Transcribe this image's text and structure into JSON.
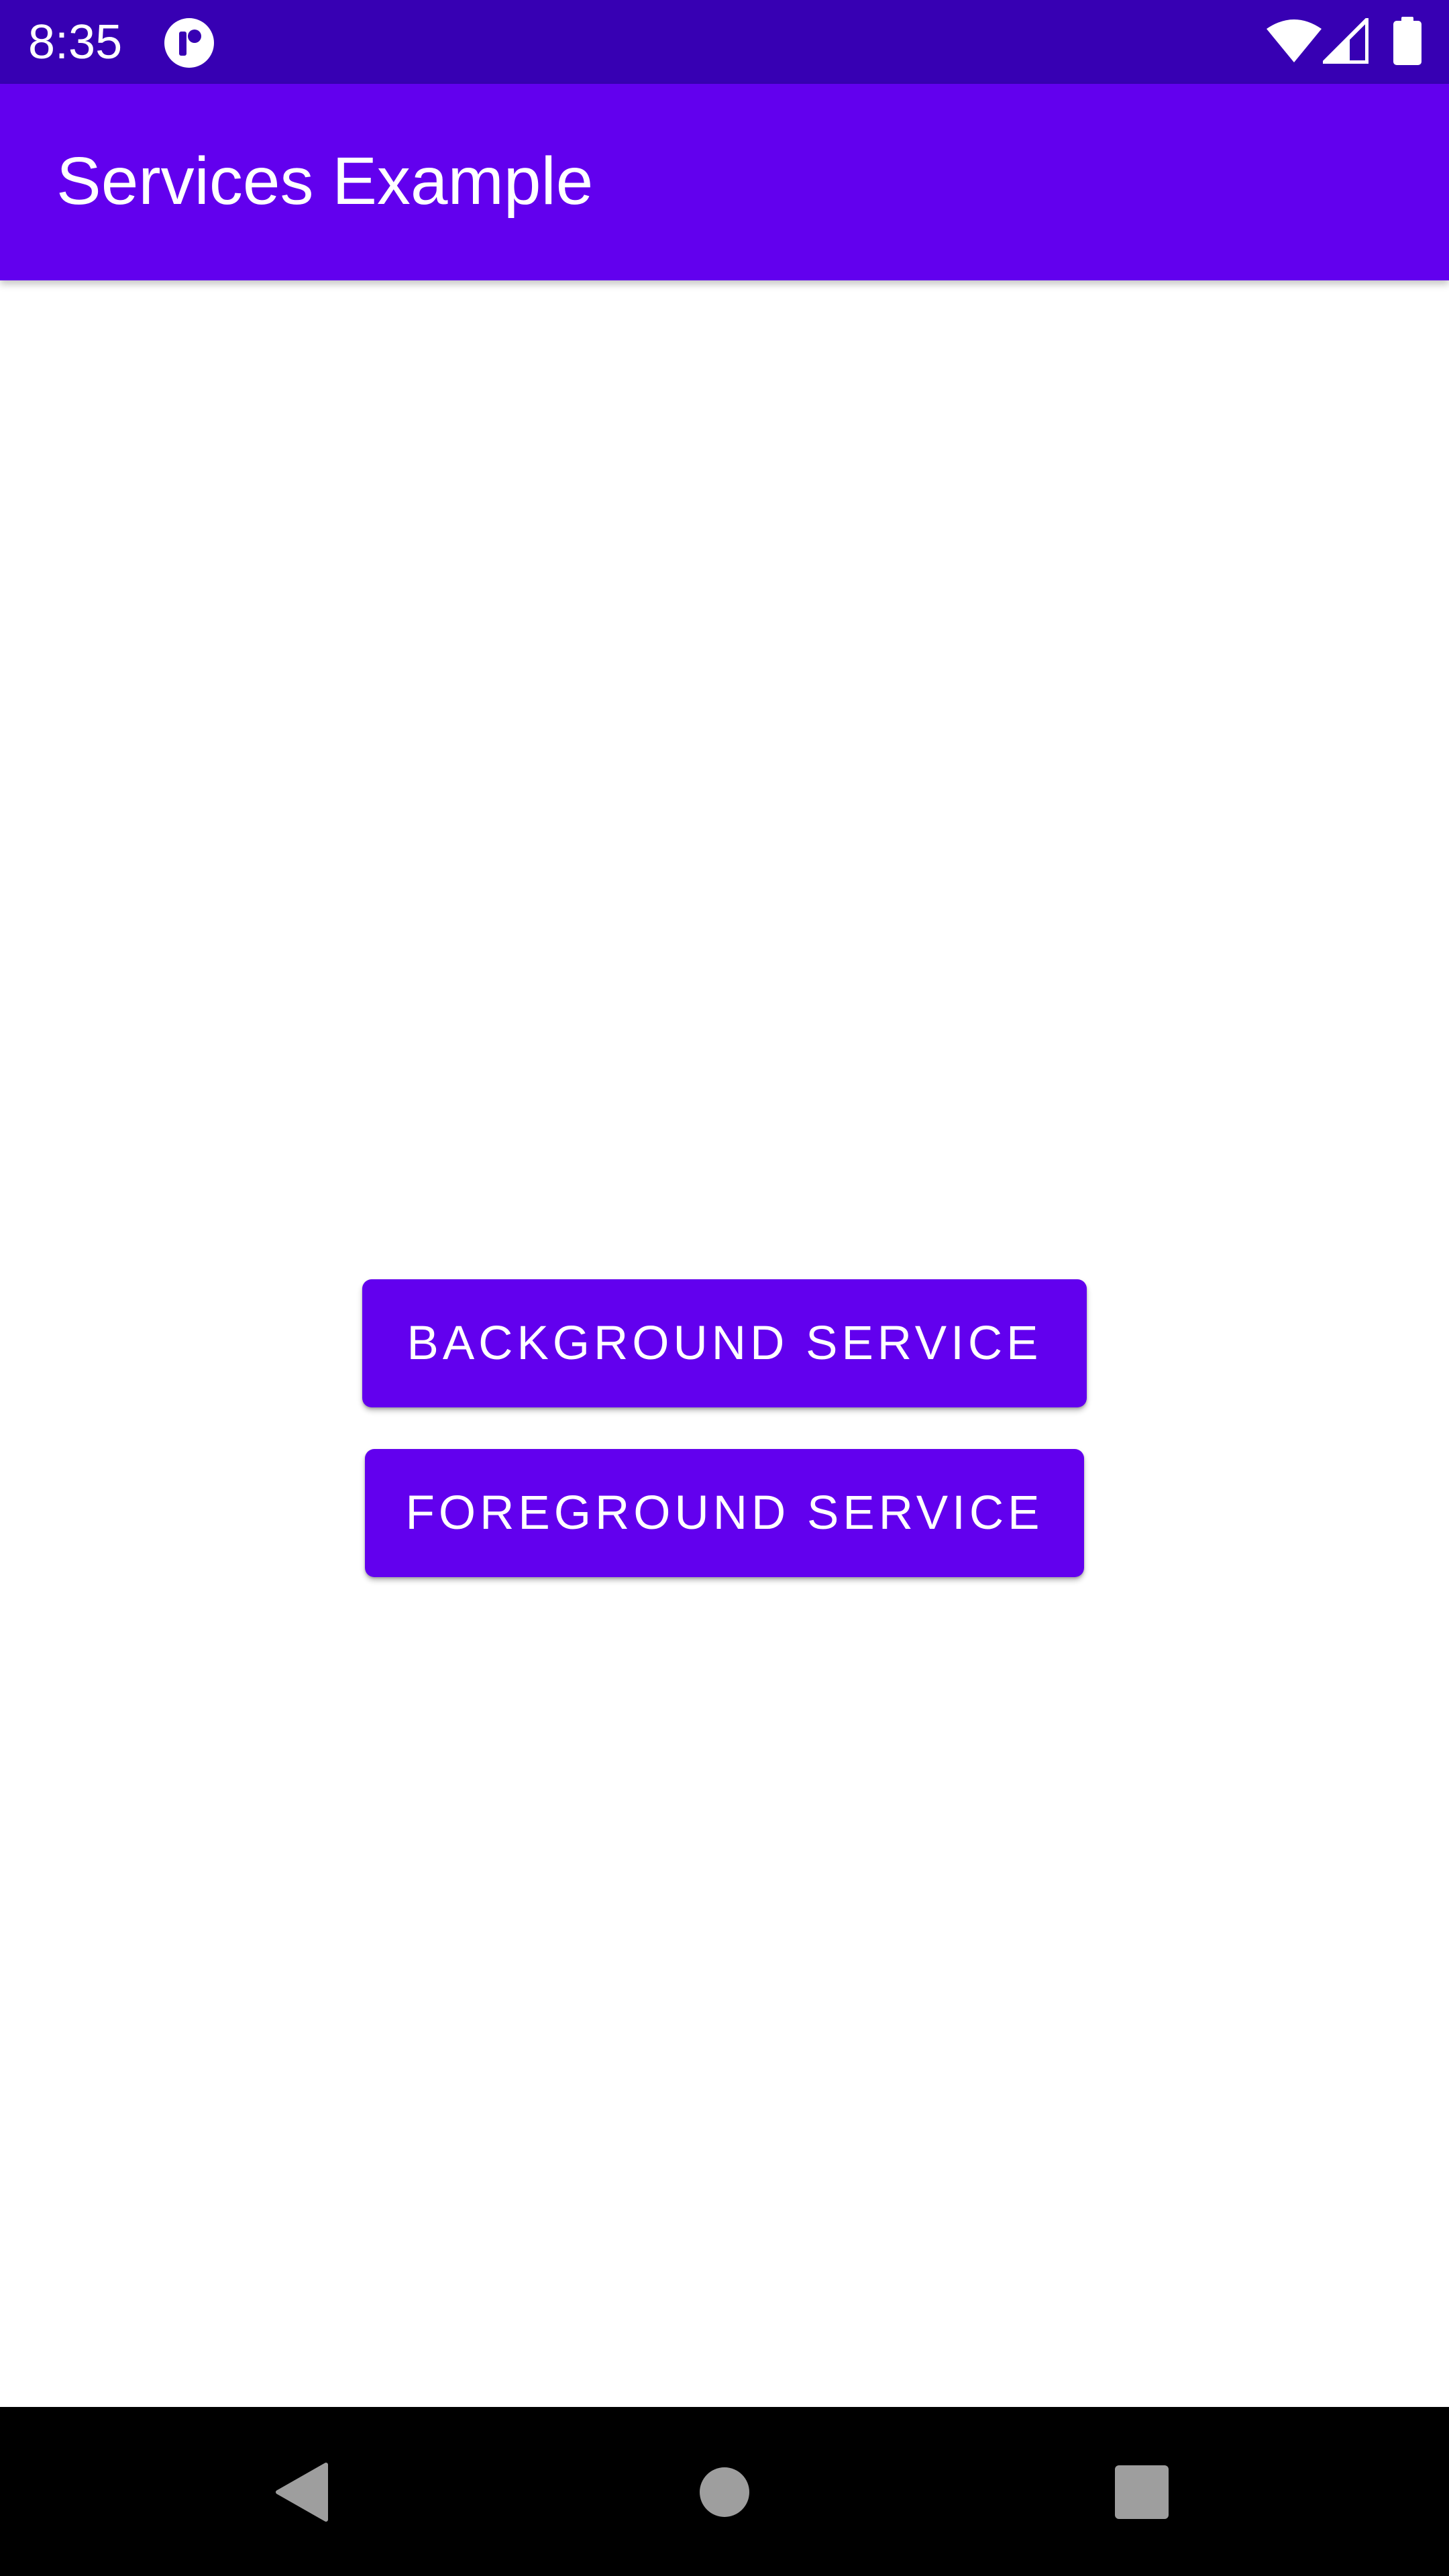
{
  "status_bar": {
    "time": "8:35",
    "icons": [
      "notification-app-icon",
      "wifi-icon",
      "cell-signal-icon",
      "battery-icon"
    ]
  },
  "app_bar": {
    "title": "Services Example"
  },
  "main": {
    "buttons": [
      {
        "label": "BACKGROUND SERVICE"
      },
      {
        "label": "FOREGROUND SERVICE"
      }
    ]
  },
  "nav_bar": {
    "icons": [
      "back-icon",
      "home-icon",
      "recents-icon"
    ]
  },
  "colors": {
    "status_bar": "#3700b3",
    "primary": "#6200ee",
    "nav_bar": "#000000",
    "nav_icons": "#9e9e9e"
  }
}
